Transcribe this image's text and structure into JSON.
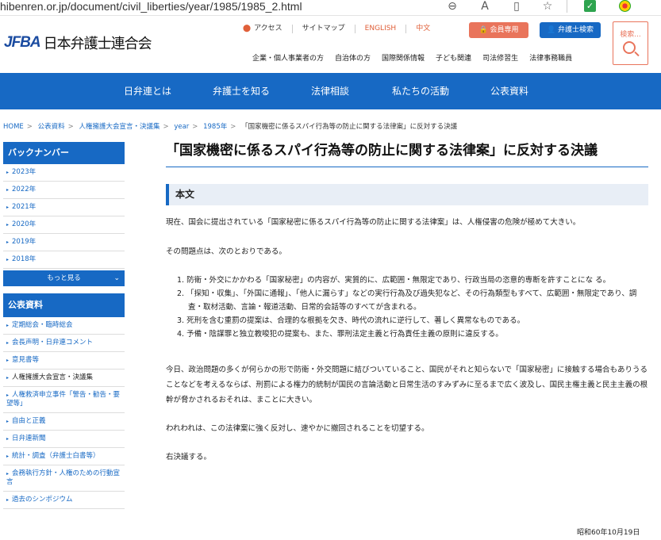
{
  "browser": {
    "url": "hibenren.or.jp/document/civil_liberties/year/1985/1985_2.html"
  },
  "header": {
    "logo_mark": "JFBA",
    "logo_text": "日本弁護士連合会",
    "utility_links": [
      "アクセス",
      "サイトマップ",
      "ENGLISH",
      "中文"
    ],
    "member_button": "会員専用",
    "lawyer_search_button": "弁護士検索",
    "search_label": "検索",
    "sub_nav": [
      "企業・個人事業者の方",
      "自治体の方",
      "国際関係情報",
      "子ども関連",
      "司法修習生",
      "法律事務職員"
    ]
  },
  "main_nav": [
    "日弁連とは",
    "弁護士を知る",
    "法律相談",
    "私たちの活動",
    "公表資料"
  ],
  "breadcrumb": [
    "HOME",
    "公表資料",
    "人権擁護大会宣言・決議集",
    "year",
    "1985年",
    "「国家機密に係るスパイ行為等の防止に関する法律案」に反対する決議"
  ],
  "sidebar": {
    "backnumber_title": "バックナンバー",
    "years": [
      "2023年",
      "2022年",
      "2021年",
      "2020年",
      "2019年",
      "2018年"
    ],
    "more_label": "もっと見る",
    "public_title": "公表資料",
    "public_items": [
      "定期総会・臨時総会",
      "会長声明・日弁連コメント",
      "意見書等",
      "人権擁護大会宣言・決議集",
      "人権救済申立事件「警告・勧告・要望等」",
      "自由と正義",
      "日弁連新聞",
      "統計・調査（弁護士白書等）",
      "会務執行方針・人権のための行動宣言",
      "過去のシンポジウム"
    ]
  },
  "content": {
    "title": "「国家機密に係るスパイ行為等の防止に関する法律案」に反対する決議",
    "section": "本文",
    "p1": "現在、国会に提出されている「国家秘密に係るスパイ行為等の防止に関する法律案」は、人権侵害の危険が極めて大きい。",
    "p2": "その問題点は、次のとおりである。",
    "items": [
      "1. 防衛・外交にかかわる「国家秘密」の内容が、実質的に、広範囲・無限定であり、行政当局の恣意的専断を許すことにな る。",
      "2. 「探知・収集」、「外国に通報」、「他人に漏らす」などの実行行為及び過失犯など、その行為類型もすべて、広範囲・無限定であり、調査・取材活動、言論・報道活動、日常的会話等のすべてが含まれる。",
      "3. 死刑を含む重罰の提案は、合理的な根拠を欠き、時代の流れに逆行して、著しく異常なものである。",
      "4. 予備・陰謀罪と独立教唆犯の提案も、また、罪刑法定主義と行為責任主義の原則に違反する。"
    ],
    "p3": "今日、政治問題の多くが何らかの形で防衛・外交問題に結びついていること、国民がそれと知らないで「国家秘密」に接触する場合もありうることなどを考えるならば、刑罰による権力的統制が国民の言論活動と日常生活のすみずみに至るまで広く波及し、国民主権主義と民主主義の根幹が脅かされるおそれは、まことに大きい。",
    "p4": "われわれは、この法律案に強く反対し、速やかに撤回されることを切望する。",
    "p5": "右決議する。",
    "date": "昭和60年10月19日"
  },
  "colors": {
    "primary": "#1769c4",
    "accent": "#e9745b"
  }
}
